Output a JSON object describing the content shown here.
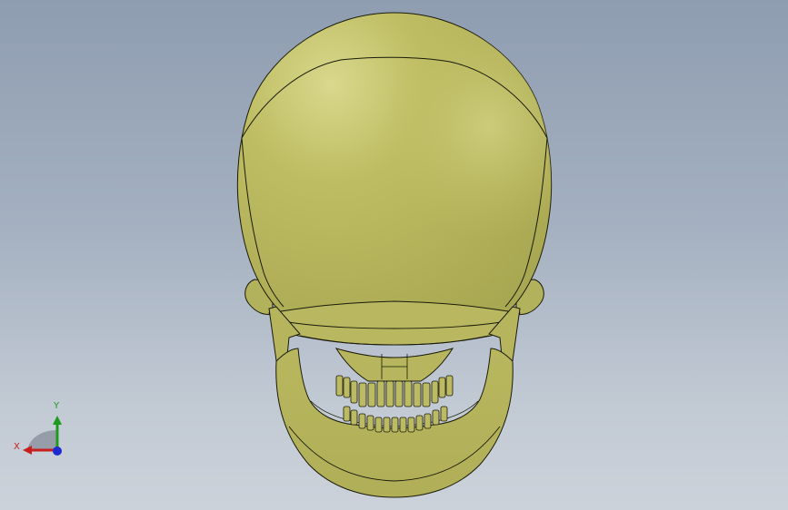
{
  "viewport": {
    "background_top": "#8f9db1",
    "background_bottom": "#ccd2da"
  },
  "model": {
    "body_color": "#b5b45c",
    "highlight_color": "#d6d58a",
    "edge_color": "#1a1a0a"
  },
  "triad": {
    "x_label": "X",
    "y_label": "Y",
    "x_color": "#c81e1e",
    "y_color": "#1e9a1e",
    "z_color": "#1e2ad0"
  }
}
